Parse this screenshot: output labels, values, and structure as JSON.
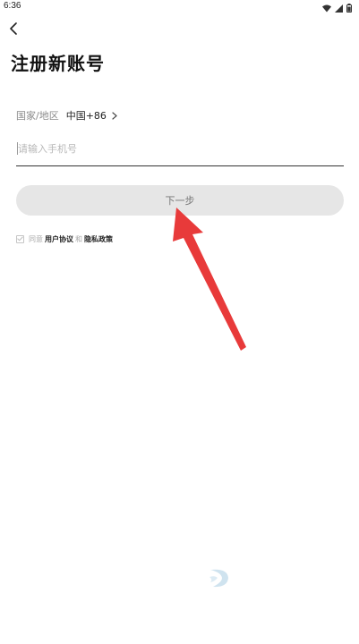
{
  "status_bar": {
    "time": "6:36",
    "icons": [
      "wifi-icon",
      "signal-icon",
      "battery-icon"
    ]
  },
  "header": {
    "back_icon": "chevron-left-icon",
    "title": "注册新账号"
  },
  "form": {
    "region_label": "国家/地区",
    "region_value": "中国+86",
    "region_chevron_icon": "chevron-right-icon",
    "phone_placeholder": "请输入手机号",
    "phone_value": "",
    "next_button_label": "下一步"
  },
  "agreement": {
    "prefix": "同意",
    "user_agreement": "用户协议",
    "joiner": "和",
    "privacy_policy": "隐私政策"
  },
  "colors": {
    "button_bg": "#e6e6e6",
    "arrow": "#e83a3a",
    "divider": "#333333"
  }
}
